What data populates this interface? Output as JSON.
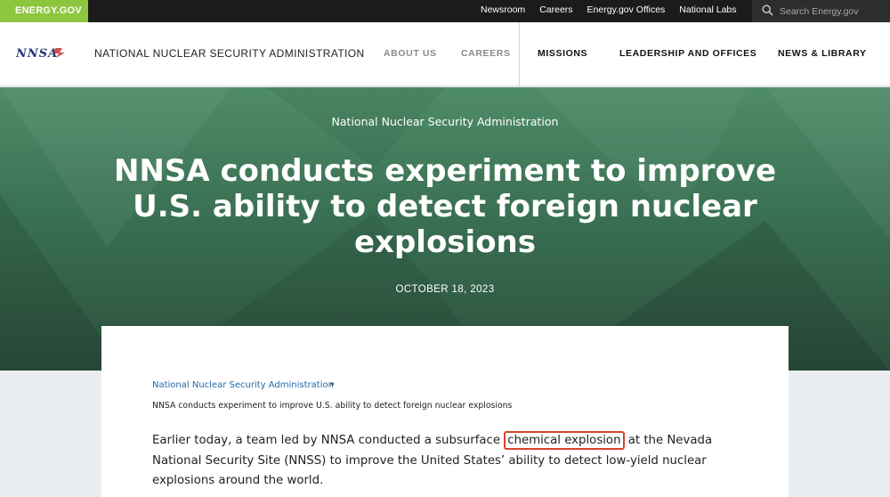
{
  "topbar": {
    "logo_label": "ENERGY.GOV",
    "links": [
      "Newsroom",
      "Careers",
      "Energy.gov Offices",
      "National Labs"
    ],
    "search_placeholder": "Search Energy.gov"
  },
  "header": {
    "logo_text": "NNSA",
    "agency_name": "NATIONAL NUCLEAR SECURITY ADMINISTRATION",
    "nav": {
      "about": "ABOUT US",
      "careers": "CAREERS",
      "missions": "MISSIONS",
      "leadership": "LEADERSHIP AND OFFICES",
      "news": "NEWS & LIBRARY"
    }
  },
  "hero": {
    "kicker": "National Nuclear Security Administration",
    "title": "NNSA conducts experiment to improve U.S. ability to detect foreign nuclear explosions",
    "date": "OCTOBER 18, 2023"
  },
  "breadcrumb": {
    "parent": "National Nuclear Security Administration",
    "separator": "»",
    "current": "NNSA conducts experiment to improve U.S. ability to detect foreign nuclear explosions"
  },
  "article": {
    "lead_before": "Earlier today, a team led by NNSA conducted a subsurface ",
    "lead_highlight": "chemical explosion",
    "lead_after": " at the Nevada National Security Site (NNSS) to improve the United States’ ability to detect low-yield nuclear explosions around the world."
  },
  "colors": {
    "energy_green": "#8cc63f",
    "hero_green": "#3a7053",
    "highlight_border": "#d8432f",
    "link_blue": "#1f68a8"
  },
  "icons": {
    "search": "search-icon",
    "logo": "nnsa-logo-icon"
  }
}
